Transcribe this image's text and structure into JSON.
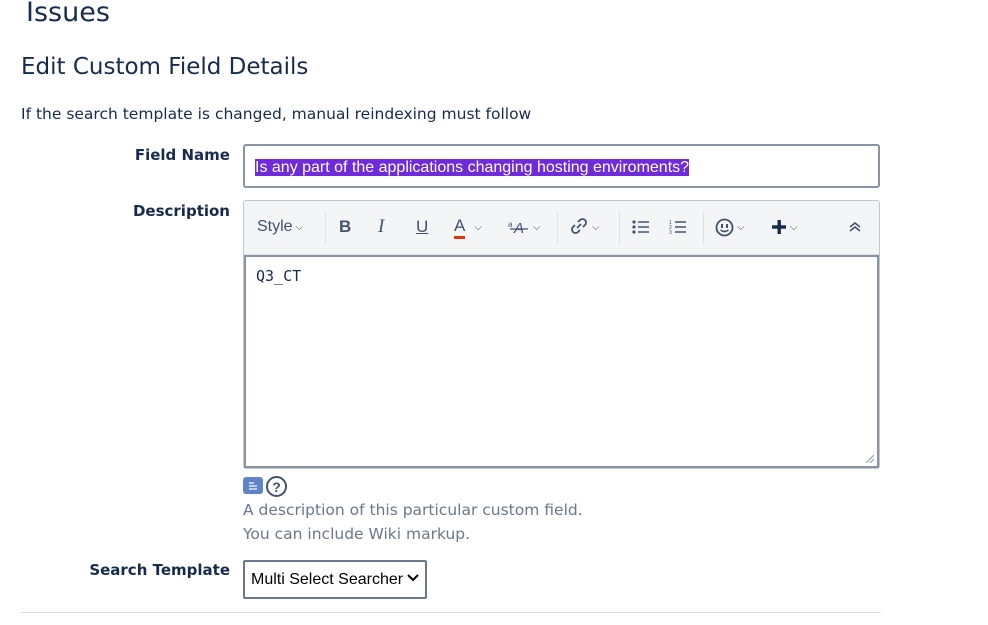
{
  "page": {
    "heading": "Issues",
    "section_title": "Edit Custom Field Details",
    "notice": "If the search template is changed, manual reindexing must follow"
  },
  "form": {
    "field_name": {
      "label": "Field Name",
      "value": "Is any part of the applications changing hosting enviroments?"
    },
    "description": {
      "label": "Description",
      "value": "Q3_CT",
      "hint_line1": "A description of this particular custom field.",
      "hint_line2": "You can include Wiki markup.",
      "help_glyph": "?"
    },
    "search_template": {
      "label": "Search Template",
      "selected": "Multi Select Searcher"
    }
  },
  "toolbar": {
    "style_label": "Style",
    "bold": "B",
    "italic": "I",
    "underline": "U",
    "text_color": "A",
    "text_color_underline": "#de350b",
    "icons": [
      "chevron-down-icon",
      "text-effects-icon",
      "link-icon",
      "bullet-list-icon",
      "numbered-list-icon",
      "emoji-icon",
      "plus-icon",
      "collapse-icon"
    ]
  },
  "colors": {
    "selection": "#6f2bd9",
    "text": "#172b4d",
    "muted": "#6b778c",
    "wiki_icon": "#5f84c7"
  }
}
